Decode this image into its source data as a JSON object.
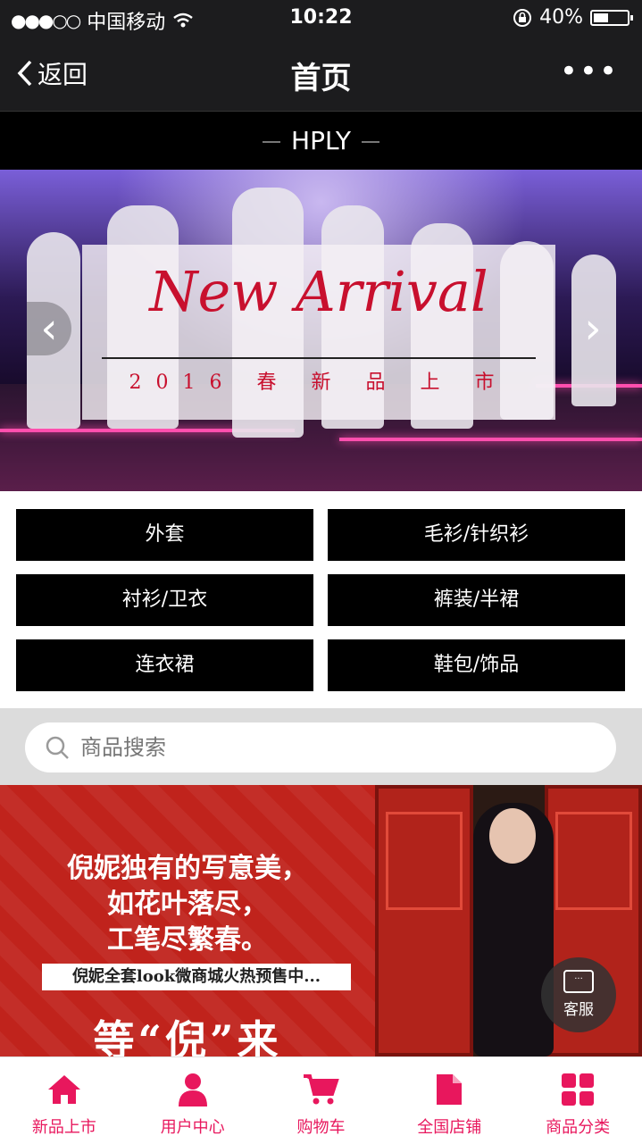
{
  "statusbar": {
    "carrier": "中国移动",
    "time": "10:22",
    "battery": "40%"
  },
  "navbar": {
    "back_label": "返回",
    "title": "首页"
  },
  "brand": {
    "name": "HPLY"
  },
  "banner": {
    "headline": "New Arrival",
    "subline": "2016 春 新 品 上 市"
  },
  "categories": [
    {
      "label": "外套"
    },
    {
      "label": "毛衫/针织衫"
    },
    {
      "label": "衬衫/卫衣"
    },
    {
      "label": "裤装/半裙"
    },
    {
      "label": "连衣裙"
    },
    {
      "label": "鞋包/饰品"
    }
  ],
  "search": {
    "placeholder": "商品搜索"
  },
  "promo": {
    "line1": "倪妮独有的写意美，",
    "line2": "如花叶落尽，",
    "line3": "工笔尽繁春。",
    "box": "倪妮全套look微商城火热预售中...",
    "big": "等“倪”来"
  },
  "customer_service": {
    "label": "客服"
  },
  "tabbar": [
    {
      "label": "新品上市",
      "icon": "home-icon"
    },
    {
      "label": "用户中心",
      "icon": "user-icon"
    },
    {
      "label": "购物车",
      "icon": "cart-icon"
    },
    {
      "label": "全国店铺",
      "icon": "document-icon"
    },
    {
      "label": "商品分类",
      "icon": "grid-icon"
    }
  ],
  "colors": {
    "accent": "#e8175d",
    "bar": "#1c1c1e"
  }
}
